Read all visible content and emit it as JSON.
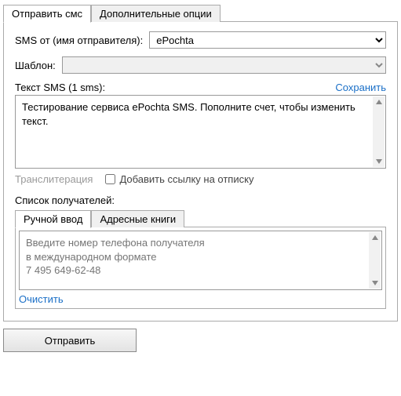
{
  "tabs": {
    "send": "Отправить смс",
    "options": "Дополнительные опции"
  },
  "sender": {
    "label": "SMS от (имя отправителя):",
    "value": "ePochta"
  },
  "template": {
    "label": "Шаблон:",
    "value": ""
  },
  "message": {
    "label": "Текст SMS (1 sms):",
    "save": "Сохранить",
    "text": "Тестирование сервиса ePochta SMS. Пополните счет, чтобы изменить текст.",
    "translit": "Транслитерация",
    "unsubscribe": "Добавить ссылку на отписку"
  },
  "recipients": {
    "label": "Список получателей:",
    "tabs": {
      "manual": "Ручной ввод",
      "books": "Адресные книги"
    },
    "placeholder": "Введите номер телефона получателя\nв международном формате\n7 495 649-62-48",
    "clear": "Очистить"
  },
  "send_button": "Отправить"
}
